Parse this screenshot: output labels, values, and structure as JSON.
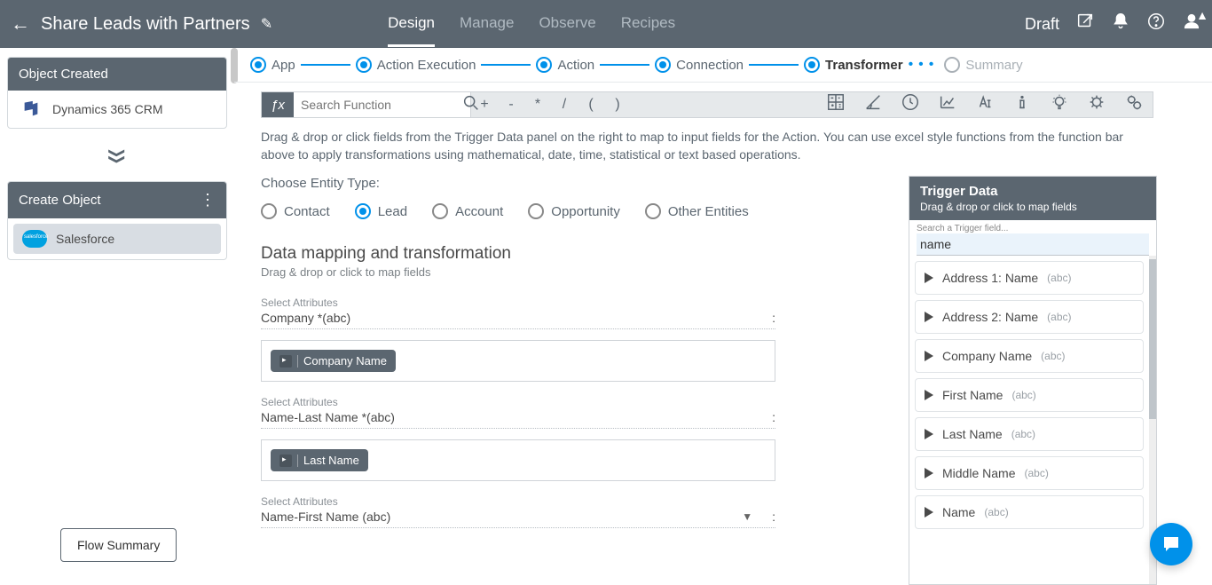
{
  "header": {
    "title": "Share Leads with Partners",
    "tabs": [
      "Design",
      "Manage",
      "Observe",
      "Recipes"
    ],
    "active_tab": 0,
    "status": "Draft"
  },
  "sidebar": {
    "card1": {
      "title": "Object Created",
      "item": "Dynamics 365 CRM"
    },
    "card2": {
      "title": "Create Object",
      "item": "Salesforce"
    },
    "flow_summary_btn": "Flow Summary"
  },
  "stepper": {
    "steps": [
      "App",
      "Action Execution",
      "Action",
      "Connection",
      "Transformer",
      "Summary"
    ],
    "active_index": 4
  },
  "fxbar": {
    "search_placeholder": "Search Function",
    "ops": [
      "+",
      "-",
      "*",
      "/",
      "(",
      ")"
    ]
  },
  "help_text": "Drag & drop or click fields from the Trigger Data panel on the right to map to input fields for the Action. You can use excel style functions from the function bar above to apply transformations using mathematical, date, time, statistical or text based operations.",
  "entity": {
    "label": "Choose Entity Type:",
    "options": [
      "Contact",
      "Lead",
      "Account",
      "Opportunity",
      "Other Entities"
    ],
    "selected_index": 1
  },
  "mapping": {
    "title": "Data mapping and transformation",
    "subtitle": "Drag & drop or click to map fields",
    "attr_hint": "Select Attributes",
    "rows": [
      {
        "label": "Company *(abc)",
        "chip": "Company Name",
        "has_dropdown": false
      },
      {
        "label": "Name-Last Name *(abc)",
        "chip": "Last Name",
        "has_dropdown": false
      },
      {
        "label": "Name-First Name (abc)",
        "chip": "",
        "has_dropdown": true
      }
    ]
  },
  "trigger_panel": {
    "title": "Trigger Data",
    "subtitle": "Drag & drop or click to map fields",
    "search_label": "Search a Trigger field...",
    "search_value": "name",
    "items": [
      {
        "name": "Address 1: Name",
        "type": "(abc)"
      },
      {
        "name": "Address 2: Name",
        "type": "(abc)"
      },
      {
        "name": "Company Name",
        "type": "(abc)"
      },
      {
        "name": "First Name",
        "type": "(abc)"
      },
      {
        "name": "Last Name",
        "type": "(abc)"
      },
      {
        "name": "Middle Name",
        "type": "(abc)"
      },
      {
        "name": "Name",
        "type": "(abc)"
      }
    ]
  }
}
